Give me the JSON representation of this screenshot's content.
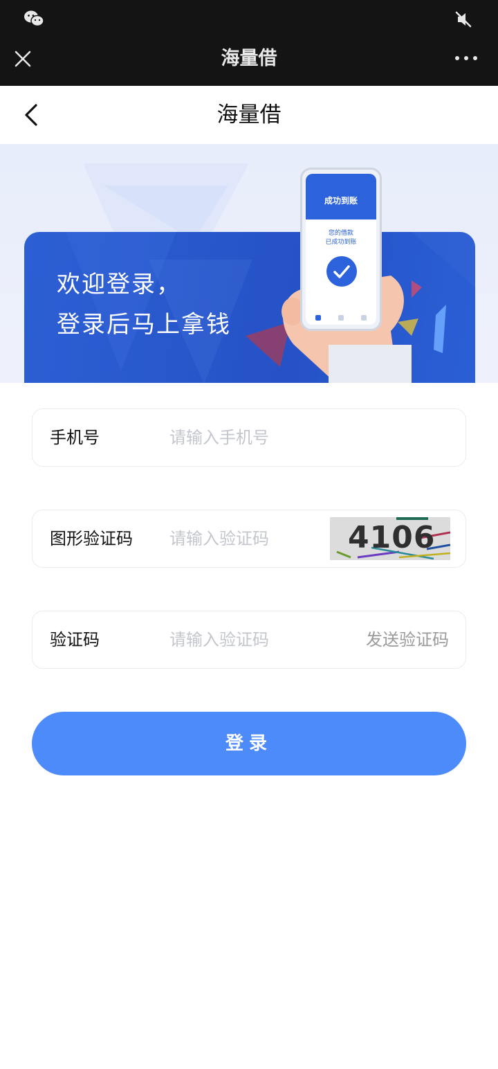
{
  "wechat_bar": {
    "title": "海量借"
  },
  "nav": {
    "title": "海量借"
  },
  "banner": {
    "line1": "欢迎登录，",
    "line2": "登录后马上拿钱",
    "phone_header": "成功到账",
    "phone_sub1": "您的借款",
    "phone_sub2": "已成功到账"
  },
  "form": {
    "phone": {
      "label": "手机号",
      "placeholder": "请输入手机号",
      "value": ""
    },
    "captcha": {
      "label": "图形验证码",
      "placeholder": "请输入验证码",
      "value": "",
      "image_text": "4106"
    },
    "sms": {
      "label": "验证码",
      "placeholder": "请输入验证码",
      "value": "",
      "send_label": "发送验证码"
    },
    "login_label": "登录"
  },
  "colors": {
    "accent": "#4d8bfb",
    "banner_blue": "#2552c6",
    "topbar": "#141414"
  },
  "icons": {
    "status_left": "wechat-icon",
    "status_right": "mute-icon",
    "close": "close-icon",
    "more": "more-icon",
    "back": "back-icon"
  }
}
